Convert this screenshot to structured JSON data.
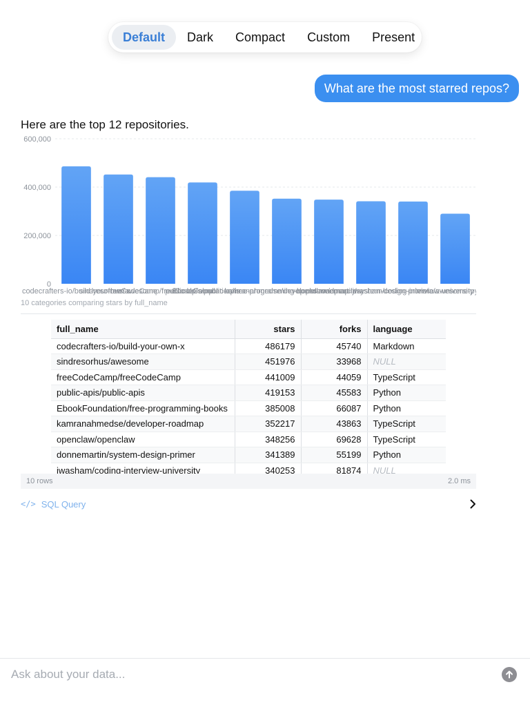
{
  "theme_switcher": {
    "options": [
      "Default",
      "Dark",
      "Compact",
      "Custom",
      "Present"
    ],
    "active": "Default"
  },
  "conversation": {
    "user_message": "What are the most starred repos?",
    "assistant_intro": "Here are the top 12 repositories."
  },
  "chart_data": {
    "type": "bar",
    "categories": [
      "codecrafters-io/build-your-own-x",
      "sindresorhus/awesome",
      "freeCodeCamp/freeCodeCamp",
      "public-apis/public-apis",
      "EbookFoundation/free-programming-books",
      "kamranahmedse/developer-roadmap",
      "openclaw/openclaw",
      "donnemartin/system-design-primer",
      "jwasham/coding-interview-university",
      "vinta/awesome-python"
    ],
    "values": [
      486179,
      451976,
      441009,
      419153,
      385008,
      352217,
      348256,
      341389,
      340253,
      290000
    ],
    "y_ticks": [
      "0",
      "200,000",
      "400,000",
      "600,000"
    ],
    "ylim": [
      0,
      600000
    ],
    "grid": true,
    "bar_color_top": "#62a4f5",
    "bar_color_bottom": "#3a86f4",
    "caption": "10 categories comparing stars by full_name"
  },
  "table": {
    "columns": [
      "full_name",
      "stars",
      "forks",
      "language"
    ],
    "rows": [
      [
        "codecrafters-io/build-your-own-x",
        "486179",
        "45740",
        "Markdown"
      ],
      [
        "sindresorhus/awesome",
        "451976",
        "33968",
        "NULL"
      ],
      [
        "freeCodeCamp/freeCodeCamp",
        "441009",
        "44059",
        "TypeScript"
      ],
      [
        "public-apis/public-apis",
        "419153",
        "45583",
        "Python"
      ],
      [
        "EbookFoundation/free-programming-books",
        "385008",
        "66087",
        "Python"
      ],
      [
        "kamranahmedse/developer-roadmap",
        "352217",
        "43863",
        "TypeScript"
      ],
      [
        "openclaw/openclaw",
        "348256",
        "69628",
        "TypeScript"
      ],
      [
        "donnemartin/system-design-primer",
        "341389",
        "55199",
        "Python"
      ],
      [
        "jwasham/coding-interview-university",
        "340253",
        "81874",
        "NULL"
      ]
    ],
    "footer_rows": "10 rows",
    "footer_time": "2.0 ms"
  },
  "sql": {
    "icon_text": "</>",
    "label": "SQL Query"
  },
  "composer": {
    "placeholder": "Ask about your data..."
  },
  "icons": {
    "sql": "code-brackets-icon",
    "expand": "chevron-right-icon",
    "send": "arrow-up-icon"
  }
}
